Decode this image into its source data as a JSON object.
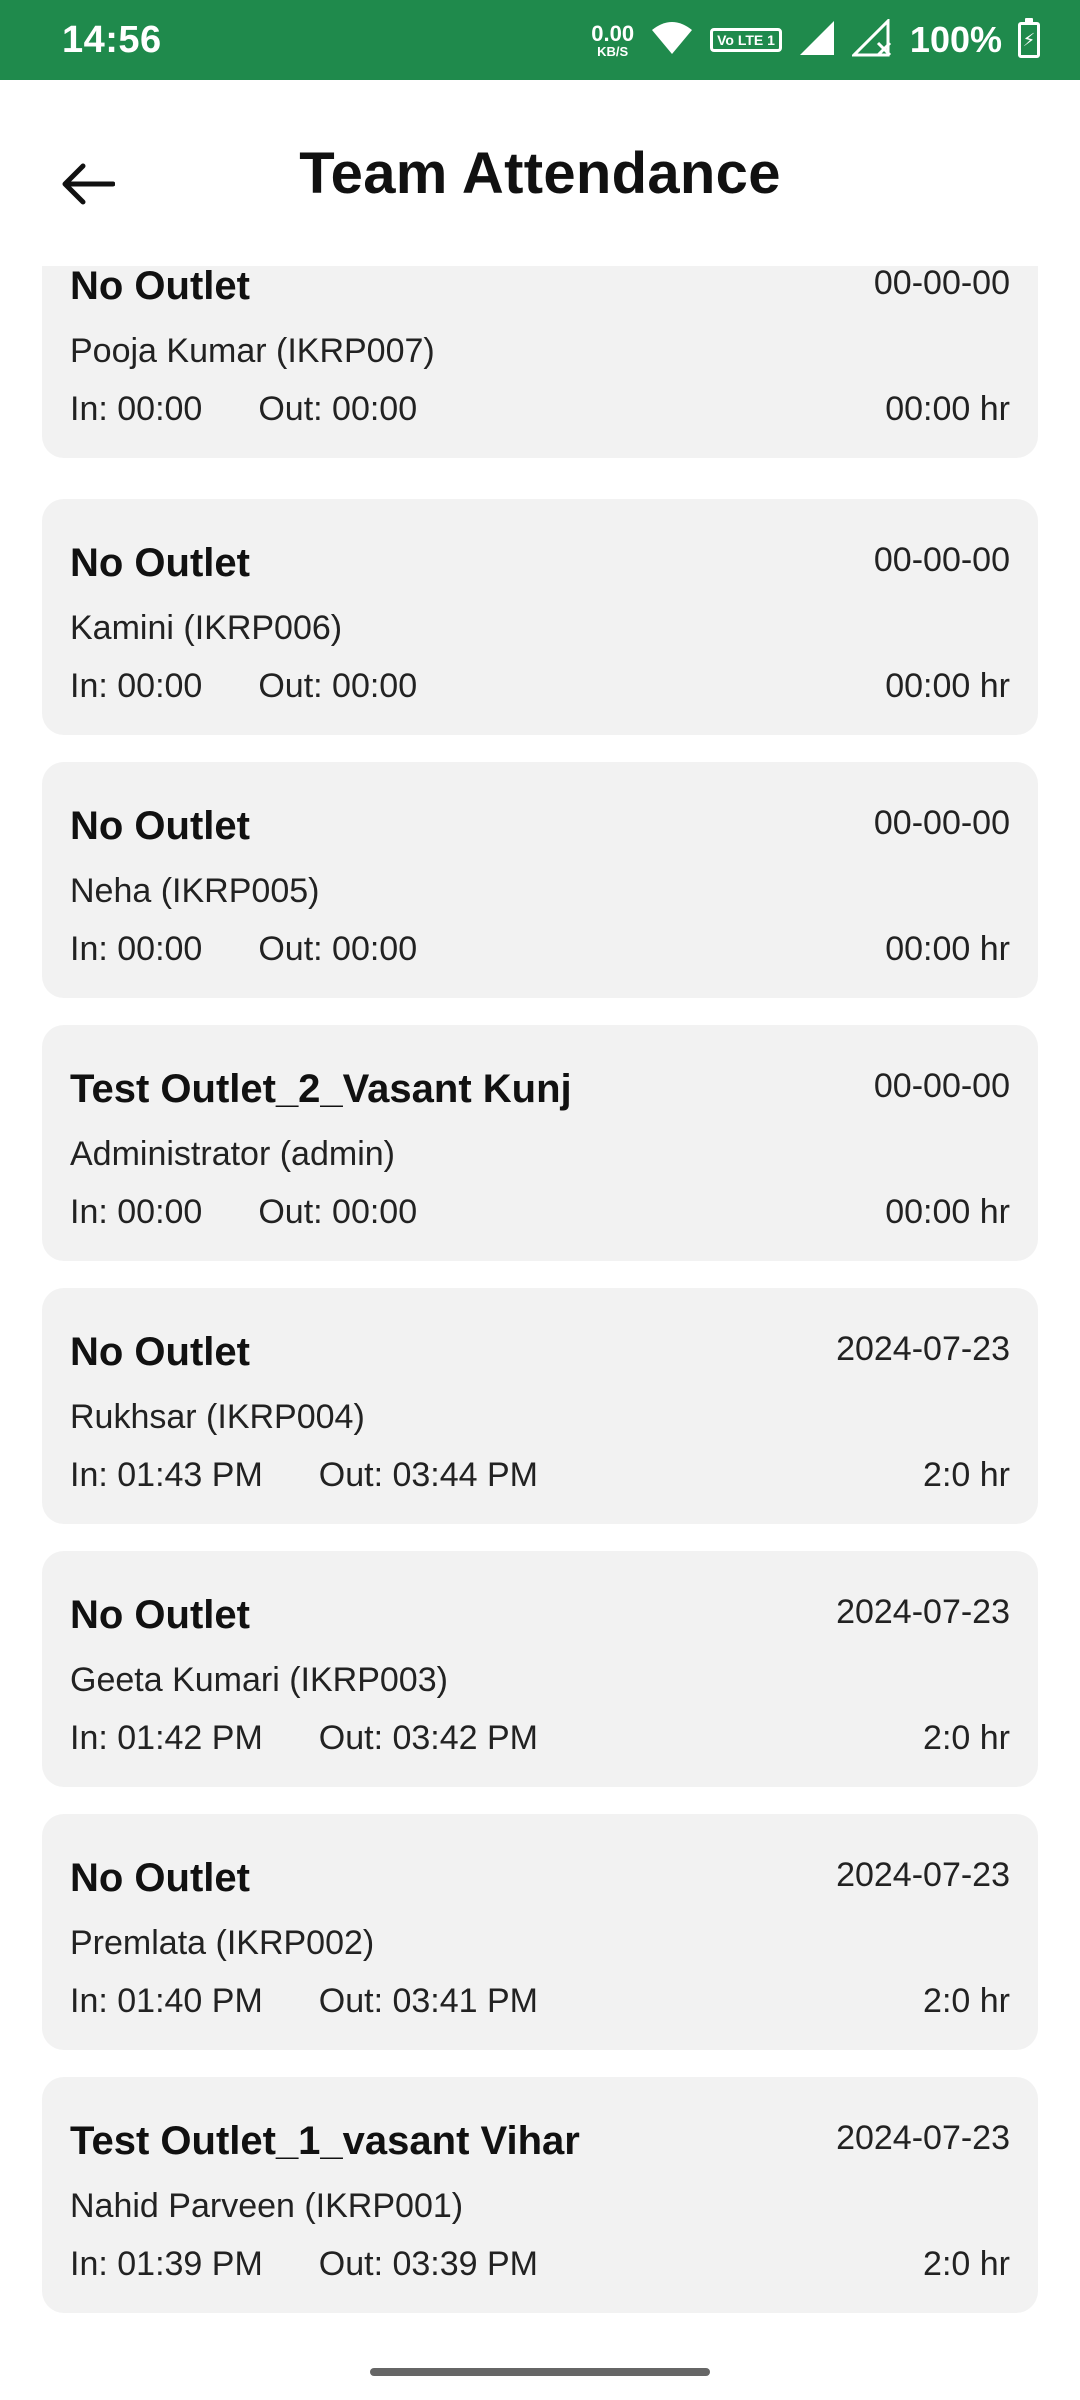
{
  "status_bar": {
    "time": "14:56",
    "net_speed_value": "0.00",
    "net_speed_unit": "KB/S",
    "volte_label": "Vo LTE 1",
    "battery_percent": "100%",
    "icons": [
      "wifi-icon",
      "volte-icon",
      "signal-icon",
      "signal-x-icon",
      "battery-charging-icon"
    ]
  },
  "header": {
    "title": "Team Attendance",
    "back_icon": "arrow-left-icon"
  },
  "records": [
    {
      "outlet": "No Outlet",
      "date": "00-00-00",
      "employee": "Pooja Kumar (IKRP007)",
      "in": "In: 00:00",
      "out": "Out: 00:00",
      "hours": "00:00 hr"
    },
    {
      "outlet": "No Outlet",
      "date": "00-00-00",
      "employee": "Kamini (IKRP006)",
      "in": "In: 00:00",
      "out": "Out: 00:00",
      "hours": "00:00 hr"
    },
    {
      "outlet": "No Outlet",
      "date": "00-00-00",
      "employee": "Neha (IKRP005)",
      "in": "In: 00:00",
      "out": "Out: 00:00",
      "hours": "00:00 hr"
    },
    {
      "outlet": "Test Outlet_2_Vasant Kunj",
      "date": "00-00-00",
      "employee": "Administrator (admin)",
      "in": "In: 00:00",
      "out": "Out: 00:00",
      "hours": "00:00 hr"
    },
    {
      "outlet": "No Outlet",
      "date": "2024-07-23",
      "employee": "Rukhsar (IKRP004)",
      "in": "In: 01:43 PM",
      "out": "Out: 03:44 PM",
      "hours": "2:0 hr"
    },
    {
      "outlet": "No Outlet",
      "date": "2024-07-23",
      "employee": "Geeta Kumari (IKRP003)",
      "in": "In: 01:42 PM",
      "out": "Out: 03:42 PM",
      "hours": "2:0 hr"
    },
    {
      "outlet": "No Outlet",
      "date": "2024-07-23",
      "employee": "Premlata (IKRP002)",
      "in": "In: 01:40 PM",
      "out": "Out: 03:41 PM",
      "hours": "2:0 hr"
    },
    {
      "outlet": "Test Outlet_1_vasant Vihar",
      "date": "2024-07-23",
      "employee": "Nahid Parveen (IKRP001)",
      "in": "In: 01:39 PM",
      "out": "Out: 03:39 PM",
      "hours": "2:0 hr"
    }
  ]
}
